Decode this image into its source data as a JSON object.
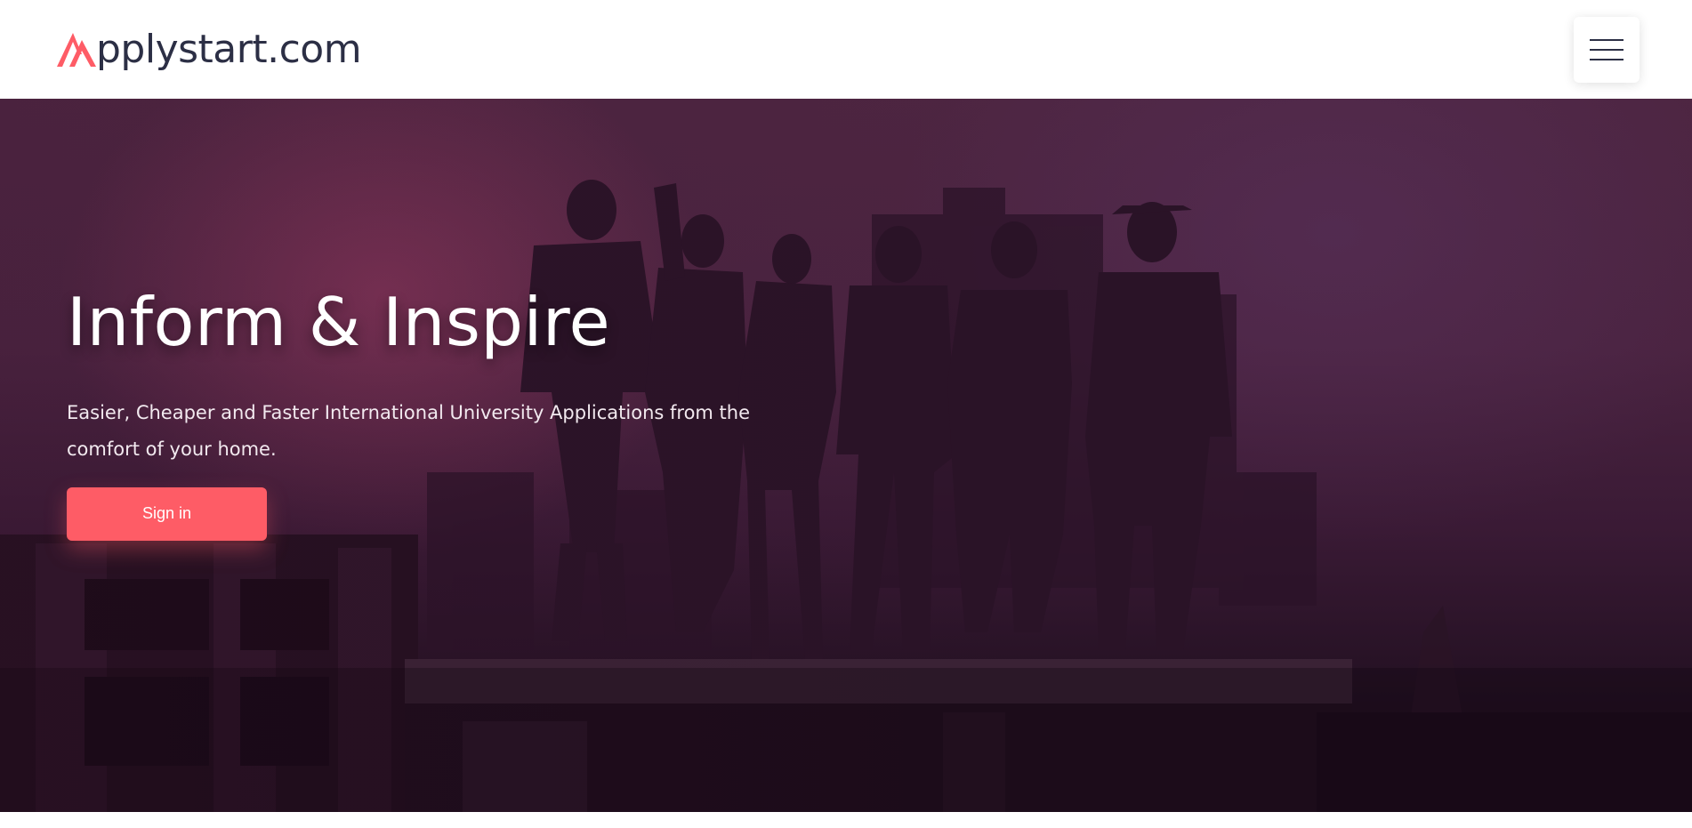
{
  "brand": {
    "name": "Applystart.com",
    "text_after_mark": "pplystart.com",
    "accent_color": "#fe5c66"
  },
  "nav": {
    "menu_icon": "hamburger-icon"
  },
  "hero": {
    "title": "Inform & Inspire",
    "subtitle": "Easier, Cheaper and Faster International University Applications from the comfort of your home.",
    "cta_label": "Sign in",
    "background": "photo-group-of-friends-on-rooftop-at-dusk"
  }
}
